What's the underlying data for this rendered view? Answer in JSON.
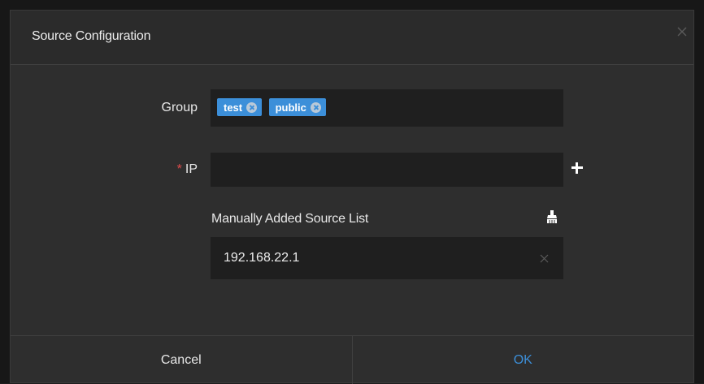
{
  "dialog": {
    "title": "Source Configuration",
    "close_icon": "close-icon"
  },
  "form": {
    "group_label": "Group",
    "groups": [
      {
        "label": "test"
      },
      {
        "label": "public"
      }
    ],
    "ip_required_mark": "*",
    "ip_label": "IP",
    "ip_value": "",
    "ip_placeholder": "",
    "add_icon": "plus-icon"
  },
  "source_list": {
    "title": "Manually Added Source List",
    "clear_icon": "broom-icon",
    "items": [
      {
        "value": "192.168.22.1"
      }
    ]
  },
  "footer": {
    "cancel_label": "Cancel",
    "ok_label": "OK"
  },
  "colors": {
    "accent": "#3c8fd9",
    "required": "#e04b4b",
    "dialog_bg": "#2e2e2e",
    "input_bg": "#1f1f1f"
  }
}
